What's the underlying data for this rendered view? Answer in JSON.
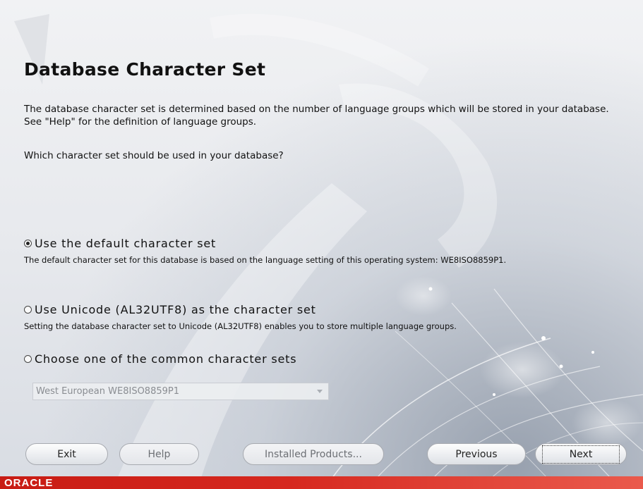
{
  "page": {
    "title": "Database Character Set",
    "intro": "The database character set is determined based on the number of language groups which will be stored in your database.  See \"Help\" for the definition of language groups.",
    "question": "Which character set should be used in your database?"
  },
  "options": [
    {
      "label": "Use the default character set",
      "description": "The default character set for this database is based on the language setting of this operating system: WE8ISO8859P1.",
      "selected": true
    },
    {
      "label": "Use Unicode (AL32UTF8) as the character set",
      "description": "Setting the database character set to Unicode (AL32UTF8) enables you to store multiple language groups.",
      "selected": false
    },
    {
      "label": "Choose one of the common character sets",
      "selected": false
    }
  ],
  "charset_select": {
    "value": "West European WE8ISO8859P1",
    "enabled": false
  },
  "buttons": {
    "exit": "Exit",
    "help": "Help",
    "installed_products": "Installed Products...",
    "previous": "Previous",
    "next": "Next"
  },
  "branding": {
    "logo_text": "ORACLE",
    "bar_color": "#d6281f"
  }
}
